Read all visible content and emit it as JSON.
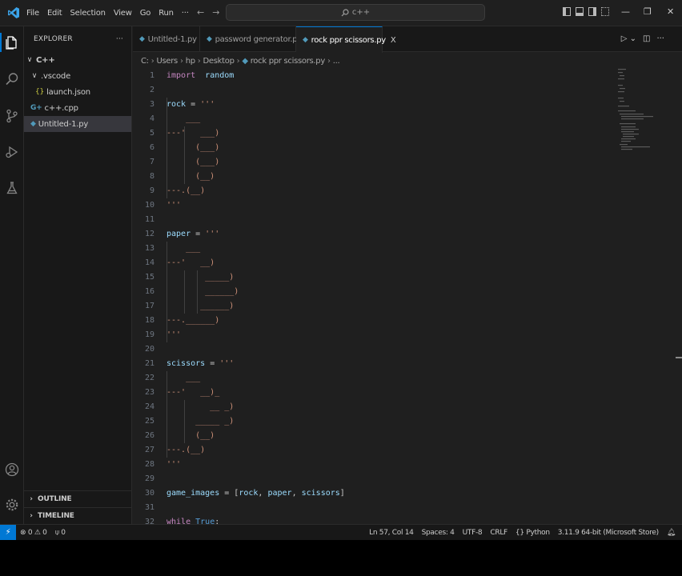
{
  "menu": [
    "File",
    "Edit",
    "Selection",
    "View",
    "Go",
    "Run",
    "···"
  ],
  "search": {
    "text": "c++"
  },
  "explorer": {
    "title": "EXPLORER",
    "more": "···",
    "root": "C++",
    "items": [
      {
        "label": ".vscode",
        "icon": "folder-chevron"
      },
      {
        "label": "launch.json",
        "icon": "json-braces-icon"
      },
      {
        "label": "c++.cpp",
        "icon": "cpp-icon"
      },
      {
        "label": "Untitled-1.py",
        "icon": "python-icon"
      }
    ],
    "outline": "OUTLINE",
    "timeline": "TIMELINE"
  },
  "tabs": [
    {
      "label": "Untitled-1.py"
    },
    {
      "label": "password generator.py"
    },
    {
      "label": "rock ppr scissors.py",
      "close": "X"
    }
  ],
  "breadcrumb": [
    "C:",
    "Users",
    "hp",
    "Desktop",
    "rock ppr scissors.py",
    "..."
  ],
  "code": [
    {
      "n": "1",
      "t": [
        [
          "kw",
          "import"
        ],
        [
          "",
          "  "
        ],
        [
          "var",
          "random"
        ]
      ]
    },
    {
      "n": "2",
      "t": []
    },
    {
      "n": "3",
      "t": [
        [
          "var",
          "rock"
        ],
        [
          "",
          " = "
        ],
        [
          "str",
          "'''"
        ]
      ]
    },
    {
      "n": "4",
      "t": [
        [
          "str",
          "    ___"
        ]
      ]
    },
    {
      "n": "5",
      "t": [
        [
          "str",
          "---'   ___)"
        ]
      ]
    },
    {
      "n": "6",
      "t": [
        [
          "str",
          "      (___)"
        ]
      ]
    },
    {
      "n": "7",
      "t": [
        [
          "str",
          "      (___)"
        ]
      ]
    },
    {
      "n": "8",
      "t": [
        [
          "str",
          "      (__)"
        ]
      ]
    },
    {
      "n": "9",
      "t": [
        [
          "str",
          "---.(__)"
        ]
      ]
    },
    {
      "n": "10",
      "t": [
        [
          "str",
          "'''"
        ]
      ]
    },
    {
      "n": "11",
      "t": []
    },
    {
      "n": "12",
      "t": [
        [
          "var",
          "paper"
        ],
        [
          "",
          " = "
        ],
        [
          "str",
          "'''"
        ]
      ]
    },
    {
      "n": "13",
      "t": [
        [
          "str",
          "    ___"
        ]
      ]
    },
    {
      "n": "14",
      "t": [
        [
          "str",
          "---'   __)"
        ]
      ]
    },
    {
      "n": "15",
      "t": [
        [
          "str",
          "        _____)"
        ]
      ]
    },
    {
      "n": "16",
      "t": [
        [
          "str",
          "        ______)"
        ]
      ]
    },
    {
      "n": "17",
      "t": [
        [
          "str",
          "       ______)"
        ]
      ]
    },
    {
      "n": "18",
      "t": [
        [
          "str",
          "---.______)"
        ]
      ]
    },
    {
      "n": "19",
      "t": [
        [
          "str",
          "'''"
        ]
      ]
    },
    {
      "n": "20",
      "t": []
    },
    {
      "n": "21",
      "t": [
        [
          "var",
          "scissors"
        ],
        [
          "",
          " = "
        ],
        [
          "str",
          "'''"
        ]
      ]
    },
    {
      "n": "22",
      "t": [
        [
          "str",
          "    ___"
        ]
      ]
    },
    {
      "n": "23",
      "t": [
        [
          "str",
          "---'   __)_"
        ]
      ]
    },
    {
      "n": "24",
      "t": [
        [
          "str",
          "         __ _)"
        ]
      ]
    },
    {
      "n": "25",
      "t": [
        [
          "str",
          "      _____ _)"
        ]
      ]
    },
    {
      "n": "26",
      "t": [
        [
          "str",
          "      (__)"
        ]
      ]
    },
    {
      "n": "27",
      "t": [
        [
          "str",
          "---.(__)"
        ]
      ]
    },
    {
      "n": "28",
      "t": [
        [
          "str",
          "'''"
        ]
      ]
    },
    {
      "n": "29",
      "t": []
    },
    {
      "n": "30",
      "t": [
        [
          "var",
          "game_images"
        ],
        [
          "",
          " = ["
        ],
        [
          "var",
          "rock"
        ],
        [
          "",
          ", "
        ],
        [
          "var",
          "paper"
        ],
        [
          "",
          ", "
        ],
        [
          "var",
          "scissors"
        ],
        [
          "",
          "]"
        ]
      ]
    },
    {
      "n": "31",
      "t": []
    },
    {
      "n": "32",
      "t": [
        [
          "kw",
          "while"
        ],
        [
          "",
          " "
        ],
        [
          "kw2",
          "True"
        ],
        [
          "",
          ":"
        ]
      ]
    }
  ],
  "status": {
    "errors": "0",
    "warnings": "0",
    "ports": "0",
    "position": "Ln 57, Col 14",
    "spaces": "Spaces: 4",
    "encoding": "UTF-8",
    "eol": "CRLF",
    "language": "Python",
    "interpreter": "3.11.9 64-bit (Microsoft Store)"
  },
  "colors": {
    "accent": "#0078d4",
    "python_icon": "#519aba",
    "string": "#ce9178",
    "keyword": "#c586c0",
    "variable": "#9cdcfe"
  }
}
